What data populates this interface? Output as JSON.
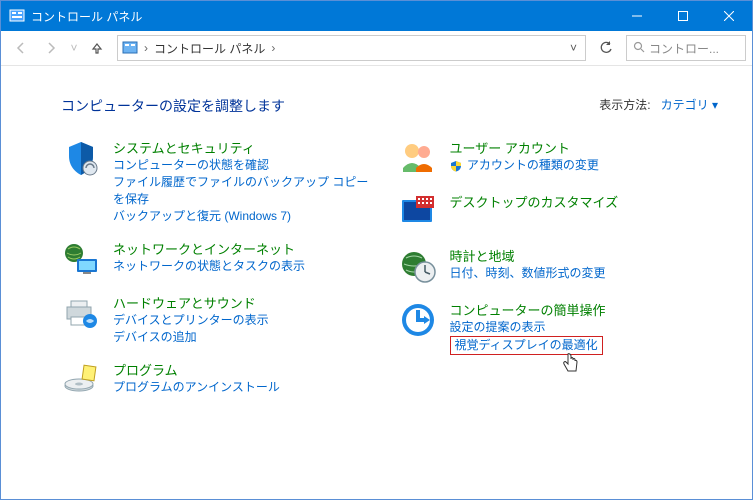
{
  "titlebar": {
    "title": "コントロール パネル"
  },
  "nav": {
    "address_text": "コントロール パネル",
    "search_placeholder": "コントロー..."
  },
  "heading": "コンピューターの設定を調整します",
  "viewby": {
    "label": "表示方法:",
    "value": "カテゴリ"
  },
  "left": {
    "system": {
      "title": "システムとセキュリティ",
      "s1": "コンピューターの状態を確認",
      "s2": "ファイル履歴でファイルのバックアップ コピーを保存",
      "s3": "バックアップと復元 (Windows 7)"
    },
    "network": {
      "title": "ネットワークとインターネット",
      "s1": "ネットワークの状態とタスクの表示"
    },
    "hardware": {
      "title": "ハードウェアとサウンド",
      "s1": "デバイスとプリンターの表示",
      "s2": "デバイスの追加"
    },
    "programs": {
      "title": "プログラム",
      "s1": "プログラムのアンインストール"
    }
  },
  "right": {
    "user": {
      "title": "ユーザー アカウント",
      "s1": "アカウントの種類の変更"
    },
    "appearance": {
      "title": "デスクトップのカスタマイズ"
    },
    "clock": {
      "title": "時計と地域",
      "s1": "日付、時刻、数値形式の変更"
    },
    "ease": {
      "title": "コンピューターの簡単操作",
      "s1": "設定の提案の表示",
      "s2": "視覚ディスプレイの最適化"
    }
  }
}
